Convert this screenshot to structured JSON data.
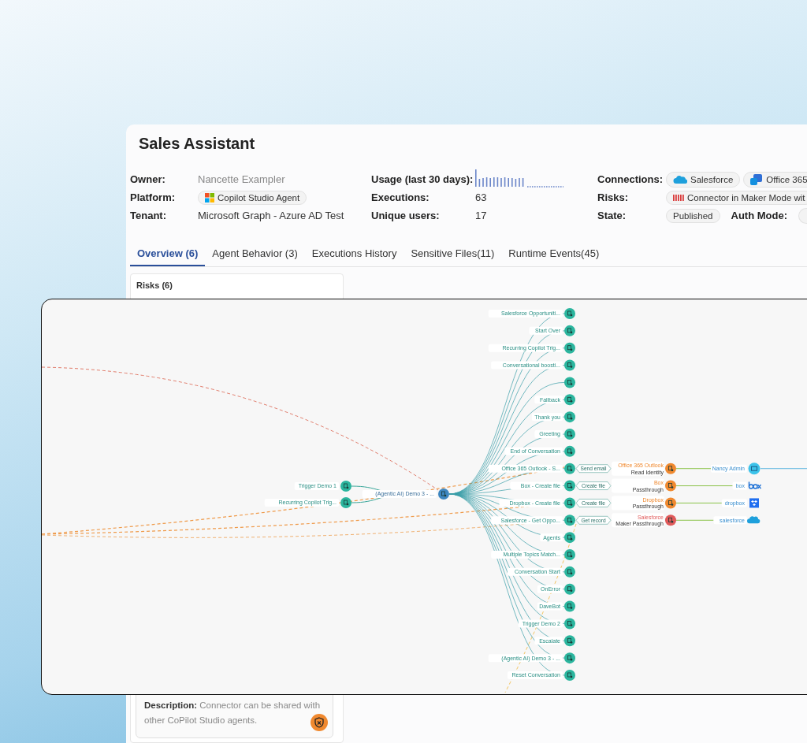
{
  "title": "Sales Assistant",
  "owner": {
    "label": "Owner:",
    "value": "Nancette Exampler"
  },
  "platform": {
    "label": "Platform:",
    "value": "Copilot Studio Agent"
  },
  "tenant": {
    "label": "Tenant:",
    "value": "Microsoft Graph - Azure AD Test"
  },
  "usage": {
    "label": "Usage (last 30 days):"
  },
  "executions": {
    "label": "Executions:",
    "value": "63"
  },
  "unique_users": {
    "label": "Unique users:",
    "value": "17"
  },
  "connections": {
    "label": "Connections:",
    "items": [
      {
        "name": "Salesforce",
        "kind": "cloud"
      },
      {
        "name": "Office 365",
        "kind": "app"
      }
    ]
  },
  "risks": {
    "label": "Risks:",
    "value": "Connector in Maker Mode wit"
  },
  "state": {
    "label": "State:",
    "value": "Published"
  },
  "auth_mode": {
    "label": "Auth Mode:"
  },
  "tabs": [
    {
      "label": "Overview (6)",
      "selected": true
    },
    {
      "label": "Agent Behavior (3)",
      "selected": false
    },
    {
      "label": "Executions History",
      "selected": false
    },
    {
      "label": "Sensitive Files(11)",
      "selected": false
    },
    {
      "label": "Runtime Events(45)",
      "selected": false
    }
  ],
  "risks_panel": {
    "title": "Risks (6)",
    "description": "**Description:** Connector can be shared with other CoPilot Studio agents."
  },
  "graph": {
    "sources": [
      {
        "label": "Trigger Demo 1"
      },
      {
        "label": "Recurring Copilot Trig..."
      }
    ],
    "hub": {
      "label": "(Agentic AI) Demo 3 - ..."
    },
    "topics": [
      {
        "label": "Salesforce Opportuniti..."
      },
      {
        "label": "Start Over"
      },
      {
        "label": "Recurring Copilot Trig..."
      },
      {
        "label": "Conversational boosti..."
      },
      {
        "kind": "unlabeled"
      },
      {
        "label": "Fallback"
      },
      {
        "label": "Thank you"
      },
      {
        "label": "Greeting"
      },
      {
        "label": "End of Conversation"
      },
      {
        "label": "Office 365 Outlook - S...",
        "action": {
          "connector": "Send email",
          "name": "Office 365 Outlook",
          "detail": "Read Identity",
          "color": "#f0892f",
          "target": {
            "label": "Nancy Admin",
            "kind": "outlook"
          }
        }
      },
      {
        "label": "Box - Create file",
        "action": {
          "connector": "Create file",
          "name": "Box",
          "detail": "Passthrough",
          "color": "#f0892f",
          "target": {
            "label": "box",
            "kind": "box"
          }
        }
      },
      {
        "label": "Dropbox - Create file",
        "action": {
          "connector": "Create file",
          "name": "Dropbox",
          "detail": "Passthrough",
          "color": "#f0892f",
          "target": {
            "label": "dropbox",
            "kind": "dropbox"
          }
        }
      },
      {
        "label": "Salesforce - Get Oppo...",
        "action": {
          "connector": "Get record",
          "name": "Salesforce",
          "detail": "Maker Passthrough",
          "color": "#e05a5a",
          "target": {
            "label": "salesforce",
            "kind": "salesforce"
          }
        }
      },
      {
        "label": "Agents"
      },
      {
        "label": "Multiple Topics Match..."
      },
      {
        "label": "Conversation Start"
      },
      {
        "label": "OnError"
      },
      {
        "label": "DaveBot"
      },
      {
        "label": "Trigger Demo 2"
      },
      {
        "label": "Escalate"
      },
      {
        "label": "(Agentic AI) Demo 3 - ..."
      },
      {
        "label": "Reset Conversation"
      }
    ]
  }
}
